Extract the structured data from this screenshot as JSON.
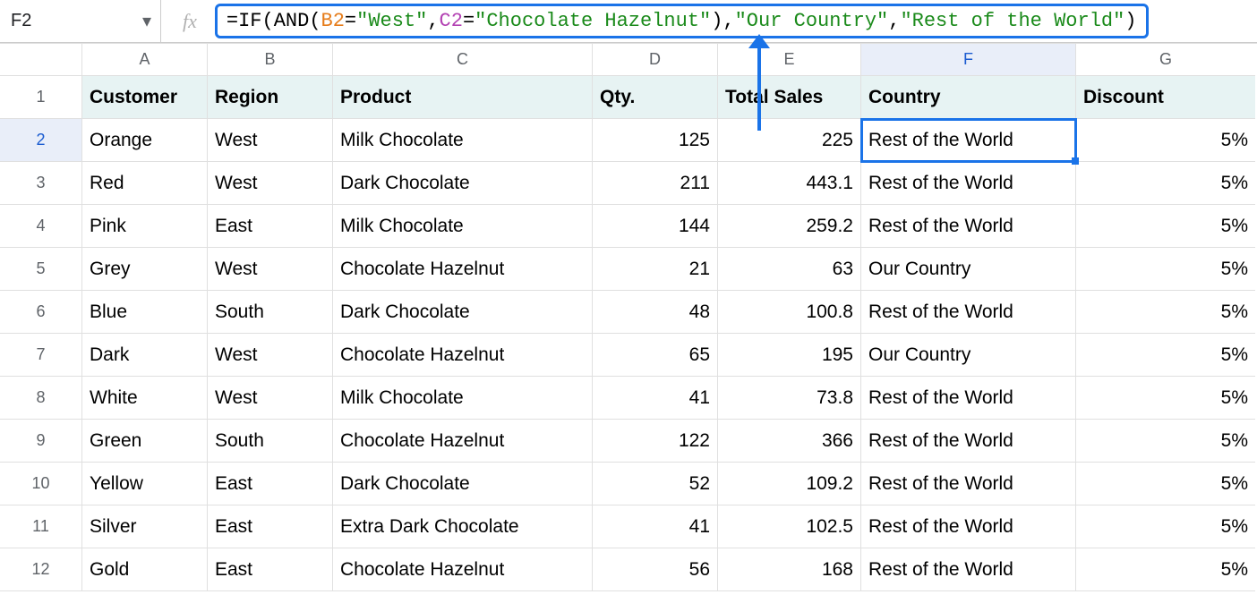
{
  "namebox": {
    "value": "F2"
  },
  "fx_label": "fx",
  "formula_tokens": [
    {
      "t": "=",
      "c": "fn"
    },
    {
      "t": "IF",
      "c": "fn"
    },
    {
      "t": "(",
      "c": "fn"
    },
    {
      "t": "AND",
      "c": "fn"
    },
    {
      "t": "(",
      "c": "fn"
    },
    {
      "t": "B2",
      "c": "ref1"
    },
    {
      "t": "=",
      "c": "fn"
    },
    {
      "t": "\"West\"",
      "c": "str"
    },
    {
      "t": ",",
      "c": "fn"
    },
    {
      "t": "C2",
      "c": "ref2"
    },
    {
      "t": "=",
      "c": "fn"
    },
    {
      "t": "\"Chocolate Hazelnut\"",
      "c": "str"
    },
    {
      "t": ")",
      "c": "fn"
    },
    {
      "t": ",",
      "c": "fn"
    },
    {
      "t": "\"Our Country\"",
      "c": "str"
    },
    {
      "t": ",",
      "c": "fn"
    },
    {
      "t": "\"Rest of the World\"",
      "c": "str"
    },
    {
      "t": ")",
      "c": "fn"
    }
  ],
  "columns": [
    "A",
    "B",
    "C",
    "D",
    "E",
    "F",
    "G"
  ],
  "headers": {
    "A": "Customer",
    "B": "Region",
    "C": "Product",
    "D": "Qty.",
    "E": "Total Sales",
    "F": "Country",
    "G": "Discount"
  },
  "selected_col": "F",
  "selected_row": 2,
  "rows": [
    {
      "n": 1,
      "header": true
    },
    {
      "n": 2,
      "A": "Orange",
      "B": "West",
      "C": "Milk Chocolate",
      "D": "125",
      "E": "225",
      "F": "Rest of the World",
      "G": "5%"
    },
    {
      "n": 3,
      "A": "Red",
      "B": "West",
      "C": "Dark Chocolate",
      "D": "211",
      "E": "443.1",
      "F": "Rest of the World",
      "G": "5%"
    },
    {
      "n": 4,
      "A": "Pink",
      "B": "East",
      "C": "Milk Chocolate",
      "D": "144",
      "E": "259.2",
      "F": "Rest of the World",
      "G": "5%"
    },
    {
      "n": 5,
      "A": "Grey",
      "B": "West",
      "C": "Chocolate Hazelnut",
      "D": "21",
      "E": "63",
      "F": "Our Country",
      "G": "5%"
    },
    {
      "n": 6,
      "A": "Blue",
      "B": "South",
      "C": "Dark Chocolate",
      "D": "48",
      "E": "100.8",
      "F": "Rest of the World",
      "G": "5%"
    },
    {
      "n": 7,
      "A": "Dark",
      "B": "West",
      "C": "Chocolate Hazelnut",
      "D": "65",
      "E": "195",
      "F": "Our Country",
      "G": "5%"
    },
    {
      "n": 8,
      "A": "White",
      "B": "West",
      "C": "Milk Chocolate",
      "D": "41",
      "E": "73.8",
      "F": "Rest of the World",
      "G": "5%"
    },
    {
      "n": 9,
      "A": "Green",
      "B": "South",
      "C": "Chocolate Hazelnut",
      "D": "122",
      "E": "366",
      "F": "Rest of the World",
      "G": "5%"
    },
    {
      "n": 10,
      "A": "Yellow",
      "B": "East",
      "C": "Dark Chocolate",
      "D": "52",
      "E": "109.2",
      "F": "Rest of the World",
      "G": "5%"
    },
    {
      "n": 11,
      "A": "Silver",
      "B": "East",
      "C": "Extra Dark Chocolate",
      "D": "41",
      "E": "102.5",
      "F": "Rest of the World",
      "G": "5%"
    },
    {
      "n": 12,
      "A": "Gold",
      "B": "East",
      "C": "Chocolate Hazelnut",
      "D": "56",
      "E": "168",
      "F": "Rest of the World",
      "G": "5%"
    }
  ],
  "numeric_cols": [
    "D",
    "E",
    "G"
  ]
}
